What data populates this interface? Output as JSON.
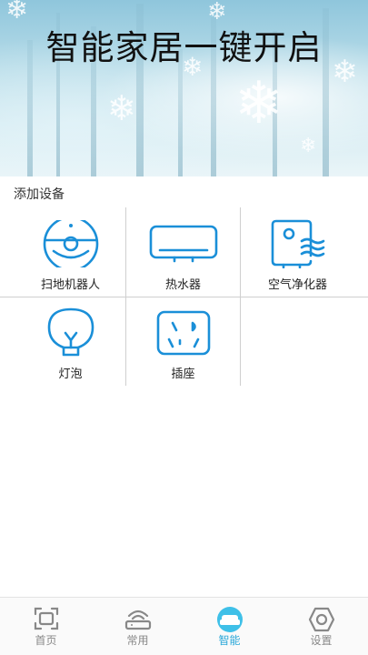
{
  "banner": {
    "title": "智能家居一键开启"
  },
  "section": {
    "title": "添加设备"
  },
  "devices": [
    {
      "label": "扫地机器人",
      "icon": "robot-vacuum-icon"
    },
    {
      "label": "热水器",
      "icon": "water-heater-icon"
    },
    {
      "label": "空气净化器",
      "icon": "air-purifier-icon"
    },
    {
      "label": "灯泡",
      "icon": "light-bulb-icon"
    },
    {
      "label": "插座",
      "icon": "power-socket-icon"
    }
  ],
  "nav": {
    "items": [
      {
        "label": "首页",
        "icon": "home-frame-icon"
      },
      {
        "label": "常用",
        "icon": "router-icon"
      },
      {
        "label": "智能",
        "icon": "sofa-icon",
        "active": true
      },
      {
        "label": "设置",
        "icon": "settings-hexagon-icon"
      }
    ]
  },
  "colors": {
    "accent": "#2aa7d8",
    "icon_blue": "#1a8fd8",
    "inactive": "#888888"
  }
}
